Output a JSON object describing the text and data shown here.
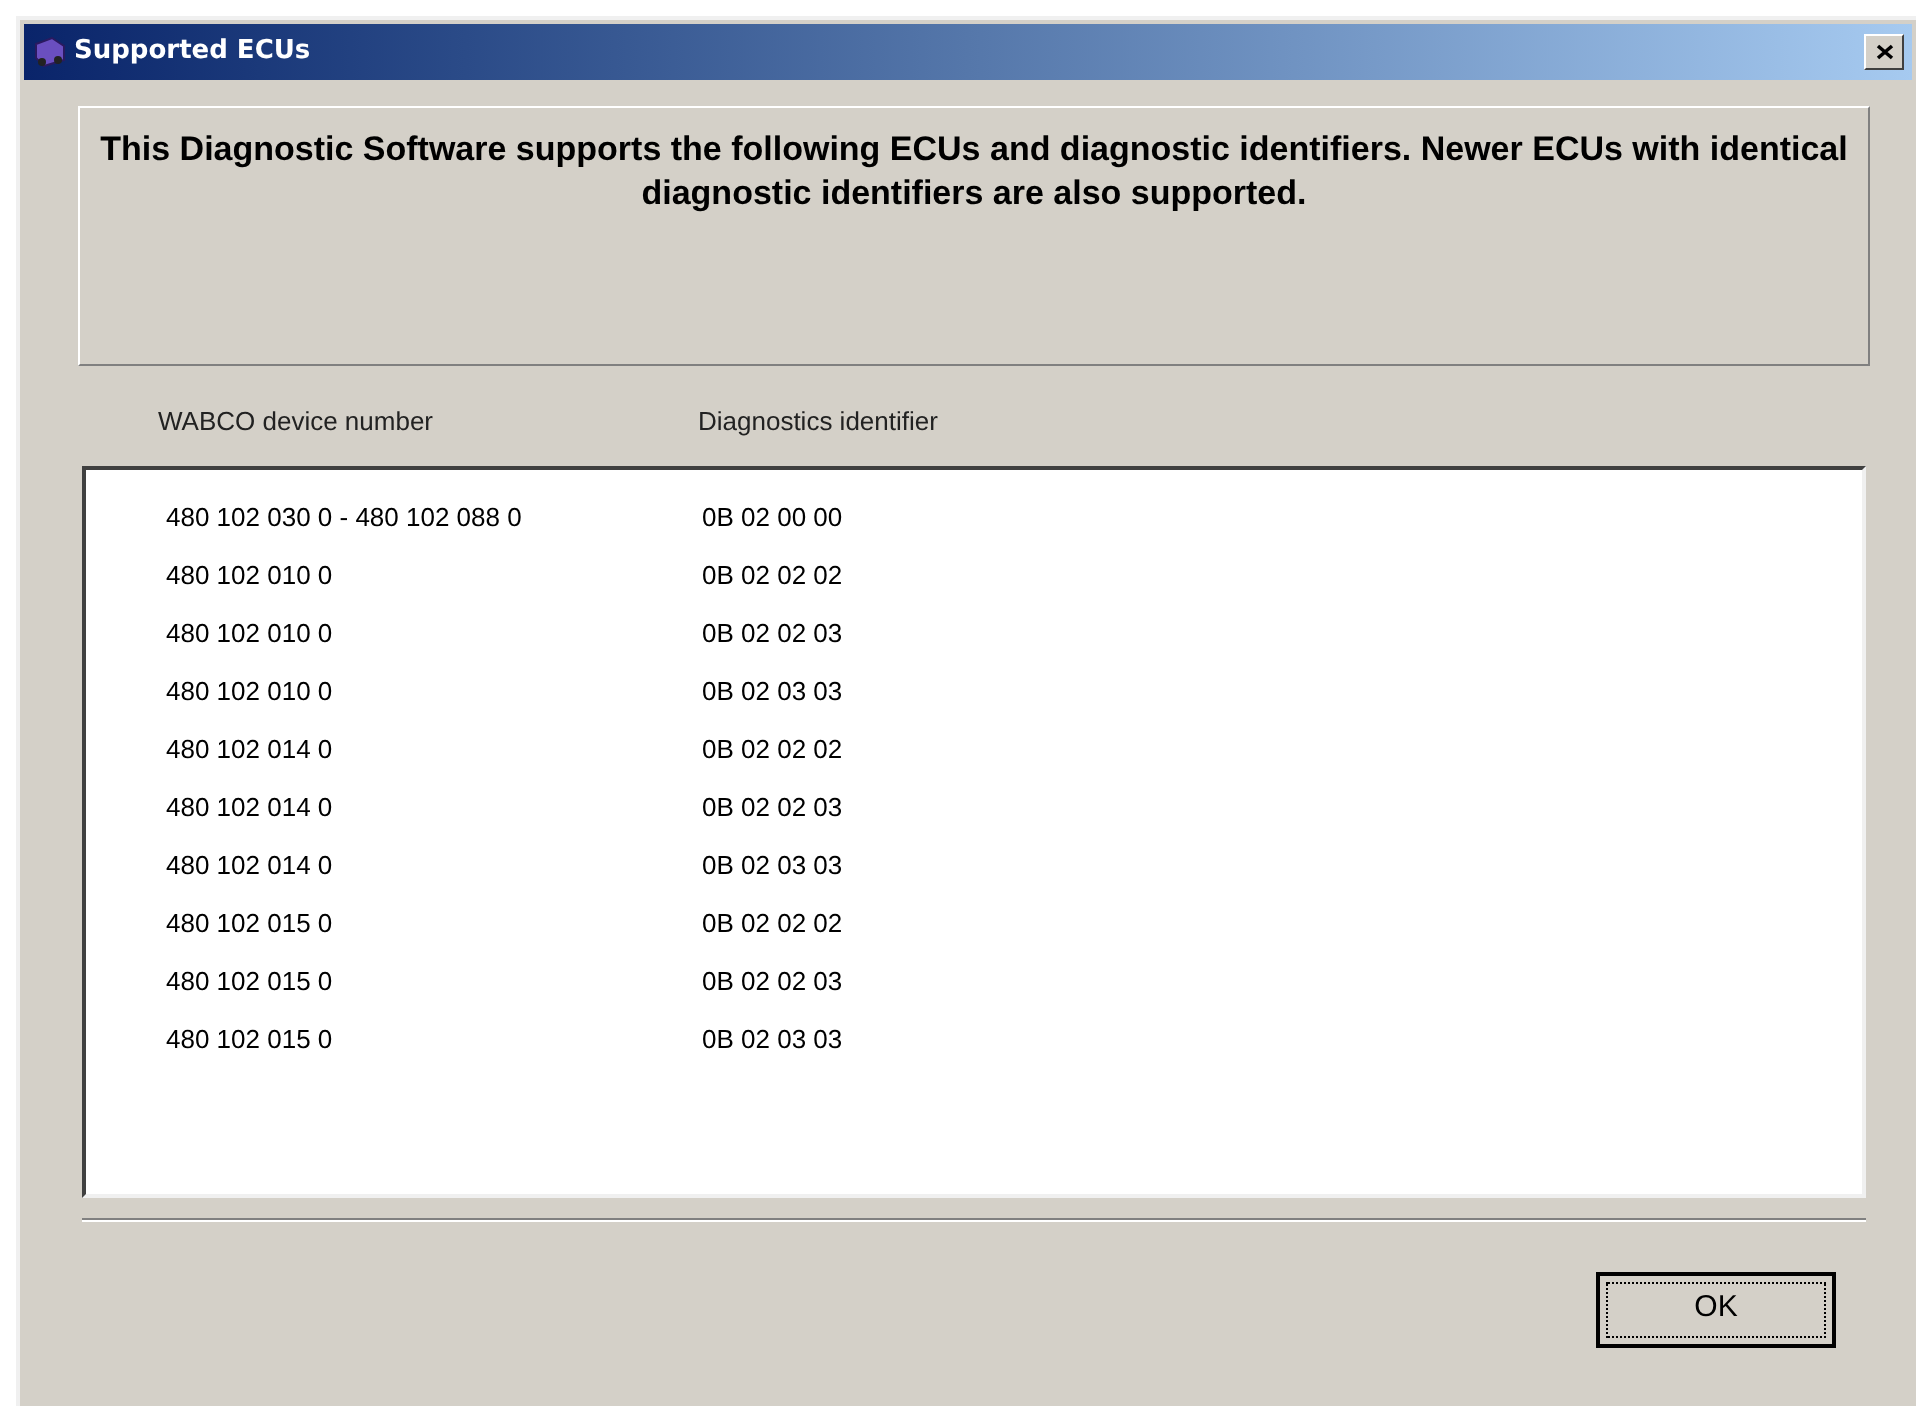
{
  "window": {
    "title": "Supported ECUs"
  },
  "message": "This Diagnostic Software supports the following ECUs and diagnostic identifiers.  Newer ECUs with identical diagnostic identifiers are also supported.",
  "table": {
    "columns": [
      "WABCO device number",
      "Diagnostics identifier"
    ],
    "rows": [
      [
        "480 102 030 0 - 480 102 088 0",
        "0B 02 00 00"
      ],
      [
        "480 102 010 0",
        "0B 02 02 02"
      ],
      [
        "480 102 010 0",
        "0B 02 02 03"
      ],
      [
        "480 102 010 0",
        "0B 02 03 03"
      ],
      [
        "480 102 014 0",
        "0B 02 02 02"
      ],
      [
        "480 102 014 0",
        "0B 02 02 03"
      ],
      [
        "480 102 014 0",
        "0B 02 03 03"
      ],
      [
        "480 102 015 0",
        "0B 02 02 02"
      ],
      [
        "480 102 015 0",
        "0B 02 02 03"
      ],
      [
        "480 102 015 0",
        "0B 02 03 03"
      ]
    ]
  },
  "buttons": [
    "OK"
  ]
}
